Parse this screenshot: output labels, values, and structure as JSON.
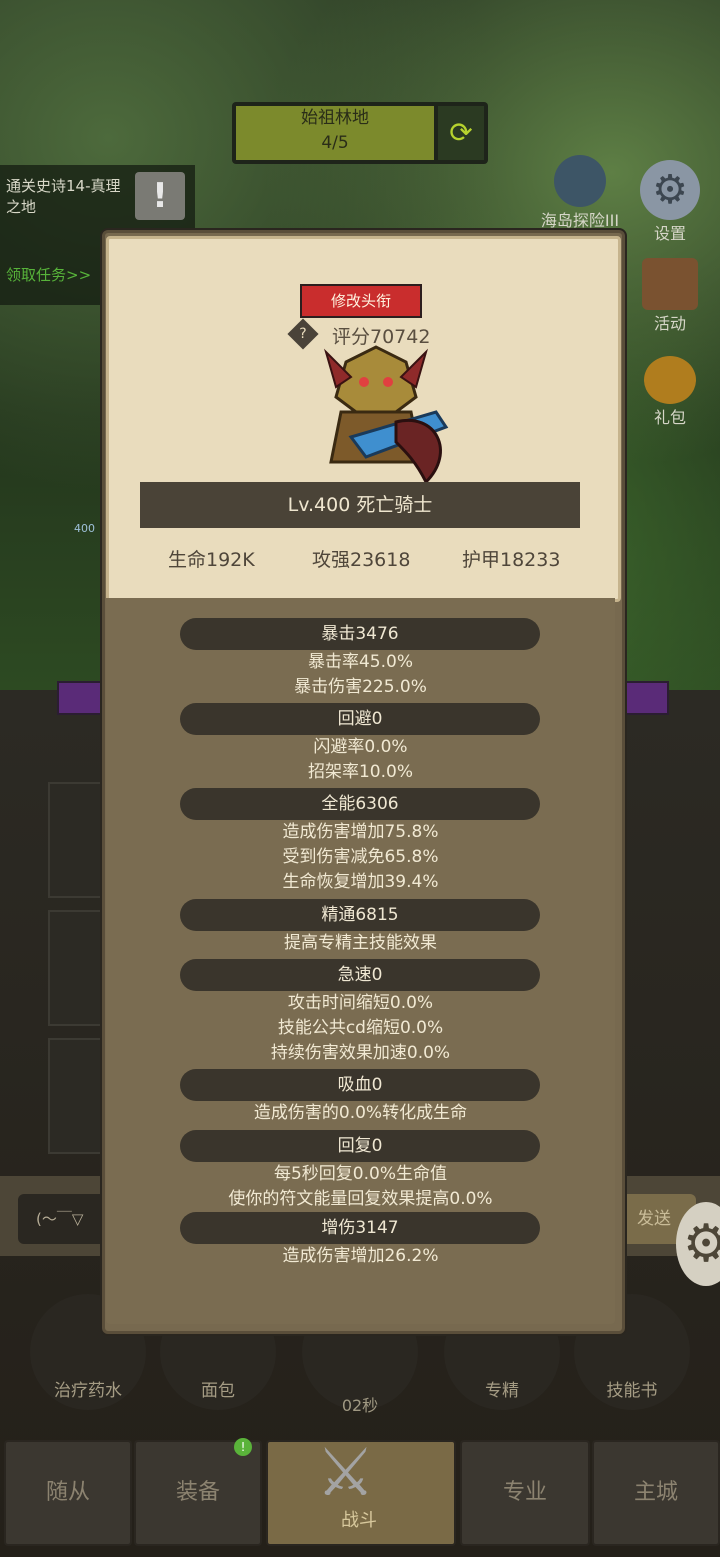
{
  "stage": {
    "name": "始祖林地",
    "progress": "4/5"
  },
  "quest": {
    "text": "通关史诗14-真理之地",
    "link": "领取任务>>"
  },
  "side_buttons": {
    "sea": "海岛探险III",
    "settings": "设置",
    "activity": "活动",
    "gift": "礼包"
  },
  "level_tag": "400",
  "chat": {
    "input": "(～￣▽",
    "send": "发送"
  },
  "actions": {
    "potion": "治疗药水",
    "bread": "面包",
    "timer": "02秒",
    "special": "专精",
    "skillbook": "技能书"
  },
  "nav": {
    "followers": "随从",
    "equip": "装备",
    "battle": "战斗",
    "profession": "专业",
    "city": "主城",
    "equip_badge": "!"
  },
  "profile": {
    "title_button": "修改头衔",
    "score": "评分70742",
    "name": "Lv.400 死亡骑士",
    "hp": "生命192K",
    "attack": "攻强23618",
    "armor": "护甲18233"
  },
  "stats": {
    "crit": "暴击3476",
    "crit_rate": "暴击率45.0%",
    "crit_dmg": "暴击伤害225.0%",
    "dodge": "回避0",
    "dodge_rate": "闪避率0.0%",
    "parry_rate": "招架率10.0%",
    "versatility": "全能6306",
    "dmg_up": "造成伤害增加75.8%",
    "dmg_taken_down": "受到伤害减免65.8%",
    "heal_up": "生命恢复增加39.4%",
    "mastery": "精通6815",
    "mastery_desc": "提高专精主技能效果",
    "haste": "急速0",
    "attack_time": "攻击时间缩短0.0%",
    "gcd": "技能公共cd缩短0.0%",
    "dot_speed": "持续伤害效果加速0.0%",
    "lifesteal": "吸血0",
    "lifesteal_desc": "造成伤害的0.0%转化成生命",
    "regen": "回复0",
    "regen_hp": "每5秒回复0.0%生命值",
    "regen_rune": "使你的符文能量回复效果提高0.0%",
    "dmg_bonus": "增伤3147",
    "dmg_bonus_desc": "造成伤害增加26.2%"
  },
  "colors": {
    "title_button": "#c92d2d",
    "panel": "#e9dcbd",
    "panel_dark": "#7a6c51",
    "stat_band": "#3a352c"
  }
}
